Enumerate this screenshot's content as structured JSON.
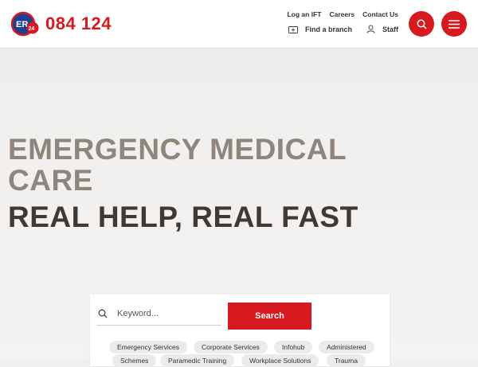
{
  "header": {
    "phone": "084 124",
    "top_links": [
      "Log an IFT",
      "Careers",
      "Contact Us"
    ],
    "find_branch": "Find a branch",
    "staff": "Staff",
    "brand_color": "#d71920"
  },
  "hero": {
    "headline_primary": "EMERGENCY MEDICAL CARE",
    "headline_secondary": "REAL HELP, REAL FAST"
  },
  "search": {
    "placeholder": "Keyword...",
    "button": "Search",
    "tags_row1": [
      "Emergency Services",
      "Corporate Services",
      "Infohub",
      "Administered"
    ],
    "tags_row2": [
      "Schemes",
      "Paramedic Training",
      "Workplace Solutions",
      "Trauma"
    ]
  },
  "icons": {
    "search": "search-icon",
    "menu": "hamburger-menu-icon",
    "branch": "location-icon",
    "staff": "user-icon"
  }
}
